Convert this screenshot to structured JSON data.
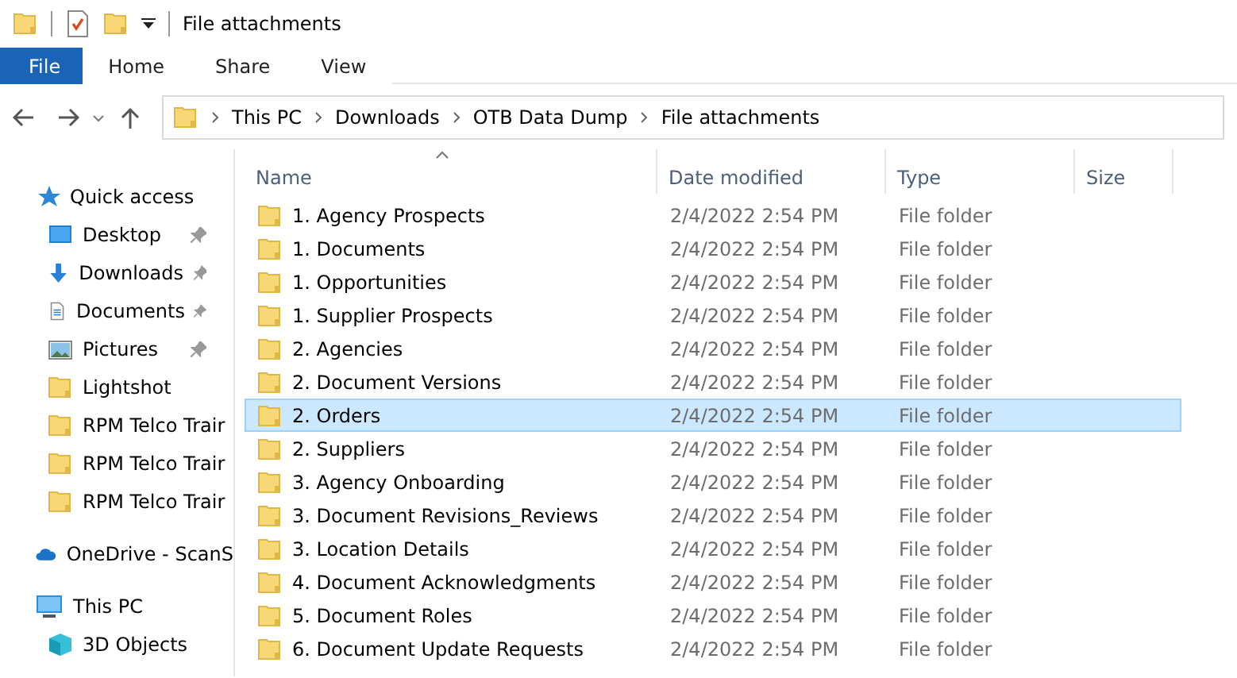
{
  "window": {
    "title": "File attachments"
  },
  "ribbon_tabs": [
    {
      "label": "File",
      "selected": true
    },
    {
      "label": "Home",
      "selected": false
    },
    {
      "label": "Share",
      "selected": false
    },
    {
      "label": "View",
      "selected": false
    }
  ],
  "address_bar": {
    "path": [
      "This PC",
      "Downloads",
      "OTB Data Dump",
      "File attachments"
    ]
  },
  "sidebar": {
    "items": [
      {
        "label": "Quick access",
        "kind": "star",
        "pinned": false
      },
      {
        "label": "Desktop",
        "kind": "desktop",
        "pinned": true
      },
      {
        "label": "Downloads",
        "kind": "download",
        "pinned": true
      },
      {
        "label": "Documents",
        "kind": "document",
        "pinned": true
      },
      {
        "label": "Pictures",
        "kind": "pictures",
        "pinned": true
      },
      {
        "label": "Lightshot",
        "kind": "folder",
        "pinned": false
      },
      {
        "label": "RPM Telco Trair",
        "kind": "folder",
        "pinned": false
      },
      {
        "label": "RPM Telco Trair",
        "kind": "folder",
        "pinned": false
      },
      {
        "label": "RPM Telco Trair",
        "kind": "folder",
        "pinned": false
      },
      {
        "label": "OneDrive - ScanS",
        "kind": "cloud",
        "pinned": false
      },
      {
        "label": "This PC",
        "kind": "pc",
        "pinned": false
      },
      {
        "label": "3D Objects",
        "kind": "cube",
        "pinned": false
      }
    ]
  },
  "table": {
    "columns": [
      {
        "label": "Name",
        "sorted": true
      },
      {
        "label": "Date modified",
        "sorted": false
      },
      {
        "label": "Type",
        "sorted": false
      },
      {
        "label": "Size",
        "sorted": false
      }
    ],
    "rows": [
      {
        "name": "1. Agency Prospects",
        "date": "2/4/2022 2:54 PM",
        "type": "File folder",
        "selected": false
      },
      {
        "name": "1. Documents",
        "date": "2/4/2022 2:54 PM",
        "type": "File folder",
        "selected": false
      },
      {
        "name": "1. Opportunities",
        "date": "2/4/2022 2:54 PM",
        "type": "File folder",
        "selected": false
      },
      {
        "name": "1. Supplier Prospects",
        "date": "2/4/2022 2:54 PM",
        "type": "File folder",
        "selected": false
      },
      {
        "name": "2. Agencies",
        "date": "2/4/2022 2:54 PM",
        "type": "File folder",
        "selected": false
      },
      {
        "name": "2. Document Versions",
        "date": "2/4/2022 2:54 PM",
        "type": "File folder",
        "selected": false
      },
      {
        "name": "2. Orders",
        "date": "2/4/2022 2:54 PM",
        "type": "File folder",
        "selected": true
      },
      {
        "name": "2. Suppliers",
        "date": "2/4/2022 2:54 PM",
        "type": "File folder",
        "selected": false
      },
      {
        "name": "3. Agency Onboarding",
        "date": "2/4/2022 2:54 PM",
        "type": "File folder",
        "selected": false
      },
      {
        "name": "3. Document Revisions_Reviews",
        "date": "2/4/2022 2:54 PM",
        "type": "File folder",
        "selected": false
      },
      {
        "name": "3. Location Details",
        "date": "2/4/2022 2:54 PM",
        "type": "File folder",
        "selected": false
      },
      {
        "name": "4. Document Acknowledgments",
        "date": "2/4/2022 2:54 PM",
        "type": "File folder",
        "selected": false
      },
      {
        "name": "5. Document Roles",
        "date": "2/4/2022 2:54 PM",
        "type": "File folder",
        "selected": false
      },
      {
        "name": "6. Document Update Requests",
        "date": "2/4/2022 2:54 PM",
        "type": "File folder",
        "selected": false
      }
    ]
  }
}
